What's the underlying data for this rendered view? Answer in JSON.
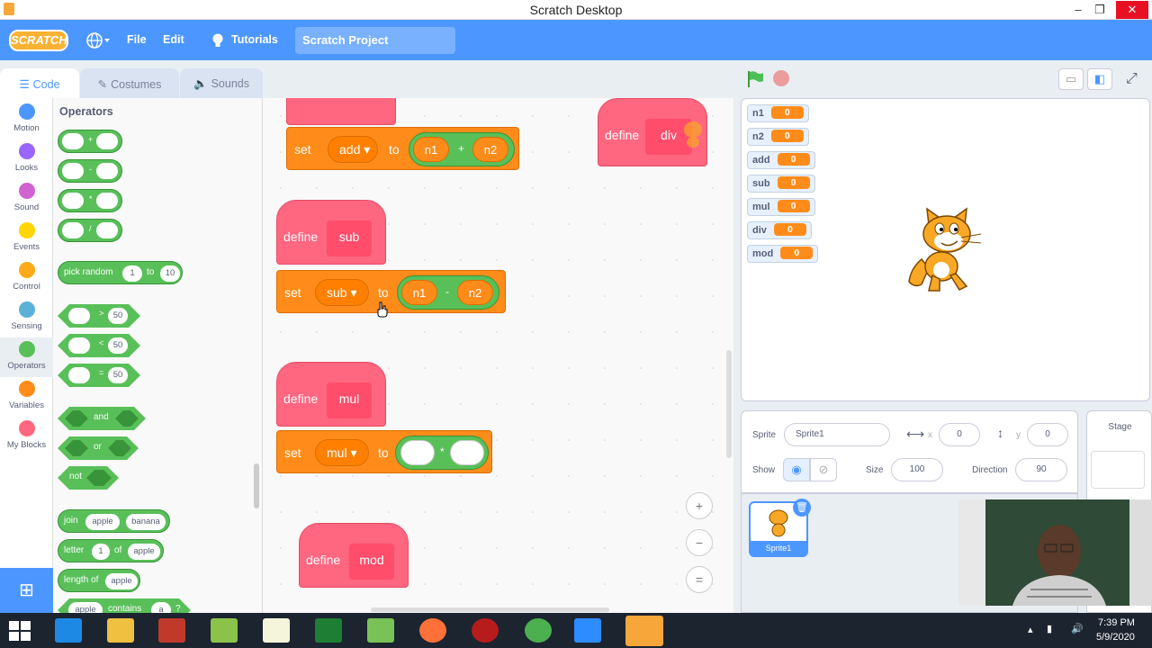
{
  "window": {
    "title": "Scratch Desktop",
    "minimize": "–",
    "restore": "❐",
    "close": "✕"
  },
  "menubar": {
    "logo": "SCRATCH",
    "file": "File",
    "edit": "Edit",
    "tutorials": "Tutorials",
    "project_title": "Scratch Project"
  },
  "tabs": {
    "code": "Code",
    "costumes": "Costumes",
    "sounds": "Sounds"
  },
  "categories": [
    {
      "label": "Motion",
      "color": "#4c97ff"
    },
    {
      "label": "Looks",
      "color": "#9966ff"
    },
    {
      "label": "Sound",
      "color": "#cf63cf"
    },
    {
      "label": "Events",
      "color": "#ffd500"
    },
    {
      "label": "Control",
      "color": "#ffab19"
    },
    {
      "label": "Sensing",
      "color": "#5cb1d6"
    },
    {
      "label": "Operators",
      "color": "#59c059"
    },
    {
      "label": "Variables",
      "color": "#ff8c1a"
    },
    {
      "label": "My Blocks",
      "color": "#ff6680"
    }
  ],
  "palette": {
    "title": "Operators",
    "arith": [
      "+",
      "-",
      "*",
      "/"
    ],
    "random": {
      "label": "pick random",
      "from": "1",
      "to_label": "to",
      "to": "10"
    },
    "compare": [
      {
        "sym": ">",
        "val": "50"
      },
      {
        "sym": "<",
        "val": "50"
      },
      {
        "sym": "=",
        "val": "50"
      }
    ],
    "logic": [
      "and",
      "or",
      "not"
    ],
    "join": {
      "label": "join",
      "a": "apple",
      "b": "banana"
    },
    "letter": {
      "label": "letter",
      "n": "1",
      "of": "of",
      "word": "apple"
    },
    "length": {
      "label": "length of",
      "word": "apple"
    },
    "contains": {
      "a": "apple",
      "label": "contains",
      "b": "a",
      "q": "?"
    }
  },
  "script": {
    "define_label": "define",
    "set_label": "set",
    "to_label": "to",
    "add_block": {
      "var": "add",
      "a": "n1",
      "op": "+",
      "b": "n2"
    },
    "div_block": {
      "name": "div"
    },
    "sub_block": {
      "name": "sub",
      "var": "sub",
      "a": "n1",
      "op": "-",
      "b": "n2"
    },
    "mul_block": {
      "name": "mul",
      "var": "mul",
      "op": "*"
    },
    "mod_block": {
      "name": "mod"
    },
    "zoom_in": "+",
    "zoom_out": "−",
    "zoom_reset": "="
  },
  "monitors": [
    {
      "name": "n1",
      "value": "0"
    },
    {
      "name": "n2",
      "value": "0"
    },
    {
      "name": "add",
      "value": "0"
    },
    {
      "name": "sub",
      "value": "0"
    },
    {
      "name": "mul",
      "value": "0"
    },
    {
      "name": "div",
      "value": "0"
    },
    {
      "name": "mod",
      "value": "0"
    }
  ],
  "sprite_info": {
    "sprite_label": "Sprite",
    "sprite_name": "Sprite1",
    "x_label": "x",
    "x": "0",
    "y_label": "y",
    "y": "0",
    "show_label": "Show",
    "size_label": "Size",
    "size": "100",
    "direction_label": "Direction",
    "direction": "90"
  },
  "sprite_list": {
    "thumb_name": "Sprite1"
  },
  "stage_panel": {
    "label": "Stage"
  },
  "taskbar": {
    "time": "7:39 PM",
    "date": "5/9/2020"
  }
}
